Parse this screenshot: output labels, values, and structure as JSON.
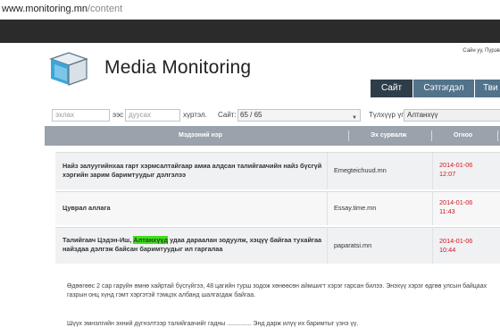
{
  "browser": {
    "url_host": "www.monitoring.mn",
    "url_path": "/content"
  },
  "header": {
    "user_info": "Сайн уу, Пүрэв",
    "brand": "Media Monitoring"
  },
  "nav": [
    "Сайт",
    "Сэтгэгдэл",
    "Тви"
  ],
  "filters": {
    "from_placeholder": "эхлах",
    "ees": "ээс",
    "to_placeholder": "дуусах",
    "hurtel": "хүртэл.",
    "site_label": "Сайт:",
    "site_value": "65 / 65",
    "keyword_label": "Түлхүүр үг:",
    "keyword_value": "Алтанхүү"
  },
  "table": {
    "columns": [
      "Мэдээний нэр",
      "Эх сурвалж",
      "Огноо"
    ],
    "rows": [
      {
        "title": "Найз залуугийнхаа гарт хэрмсалтайгаар амиа алдсан талийгаачийн найз бүсгүй хэргийн зарим баримтуудыг дэлгэлээ",
        "source": "Emegteichuud.mn",
        "date": "2014-01-06",
        "time": "12:07"
      },
      {
        "title": "Цуврал аллага",
        "source": "Essay.time.mn",
        "date": "2014-01-06",
        "time": "11:43"
      },
      {
        "title_before": "Талийгаач Цэдэн-Иш, ",
        "title_highlight": "Алтанхүүд",
        "title_after": " удаа дараалан зодуулж, хэцүү байгаа тухайгаа найздаа дэлгэж байсан баримтуудыг ил гаргалаа",
        "source": "paparatsi.mn",
        "date": "2014-01-06",
        "time": "10:44"
      }
    ]
  },
  "paragraphs": [
    "Өдөөгөөс 2 сар гаруйн өмнө хайртай бүсгүйгээ, 48 цагийн турш зодож хөнөөсөн аймшигт хэрэг гарсан билээ. Энэхүү хэрэг өдгөө улсын байцаах газрын онц хүнд гэмт хэргэтэй тэмцэх албанд шалгагдаж байгаа.",
    "Шүүх эмнэлгийн эхний дүгнэлтээр талийгаачийг гадны .............. Энд дарж илүү их баримтыг үзнэ үү."
  ]
}
